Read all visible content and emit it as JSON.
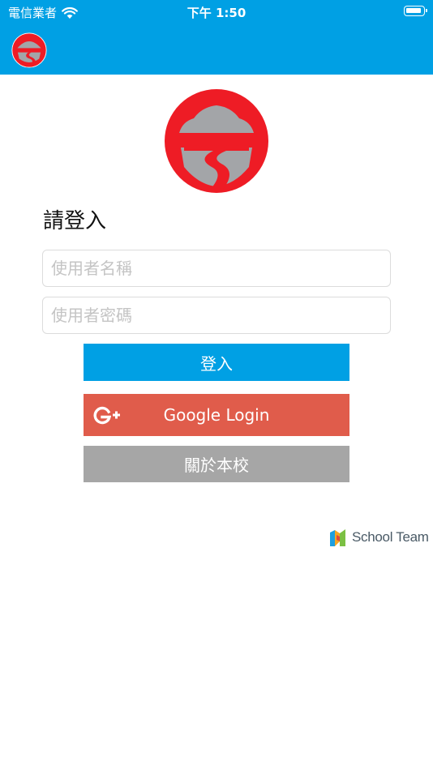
{
  "status_bar": {
    "carrier": "電信業者",
    "time": "下午 1:50"
  },
  "icons": {
    "wifi": "wifi-icon",
    "battery": "battery-icon",
    "app_logo": "university-logo-icon",
    "google_plus": "google-plus-icon",
    "brand": "school-team-logo-icon"
  },
  "login": {
    "title": "請登入",
    "username_placeholder": "使用者名稱",
    "password_placeholder": "使用者密碼",
    "login_label": "登入",
    "google_label": "Google Login",
    "about_label": "關於本校"
  },
  "footer": {
    "brand_name": "School Team"
  },
  "colors": {
    "header": "#00a0e4",
    "login_button": "#00a0e4",
    "google_button": "#e05c4b",
    "about_button": "#a6a6a6",
    "logo_red": "#ee1c25",
    "logo_gray": "#a3a5a8"
  }
}
